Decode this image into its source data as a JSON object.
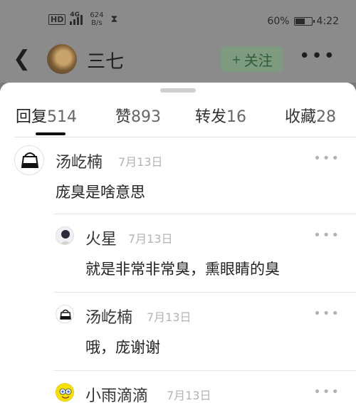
{
  "status_bar": {
    "hd_label": "HD",
    "network_label": "4G",
    "speed_value": "624",
    "speed_unit": "B/s",
    "battery_percent": "60%",
    "battery_level": 0.6,
    "time": "4:22"
  },
  "navbar": {
    "back_icon": "chevron-left",
    "username": "三七",
    "follow_label": "关注",
    "follow_plus": "+",
    "more_icon": "•••"
  },
  "tabs": [
    {
      "label": "回复",
      "count": "514"
    },
    {
      "label": "赞",
      "count": "893"
    },
    {
      "label": "转发",
      "count": "16"
    },
    {
      "label": "收藏",
      "count": "28"
    }
  ],
  "comments": [
    {
      "name": "汤屹楠",
      "date": "7月13日",
      "text": "庞臭是啥意思",
      "more": "•••"
    },
    {
      "name": "火星",
      "date": "7月13日",
      "text": "就是非常非常臭，熏眼睛的臭",
      "more": "•••"
    },
    {
      "name": "汤屹楠",
      "date": "7月13日",
      "text": "哦，庞谢谢",
      "more": "•••"
    },
    {
      "name": "小雨滴滴",
      "date": "7月13日",
      "more": "•••"
    }
  ],
  "colors": {
    "overlay": "#8b8b8b",
    "follow_bg": "#7e9a80",
    "follow_text": "#2f5e34",
    "date_gray": "#b3b3b3"
  }
}
